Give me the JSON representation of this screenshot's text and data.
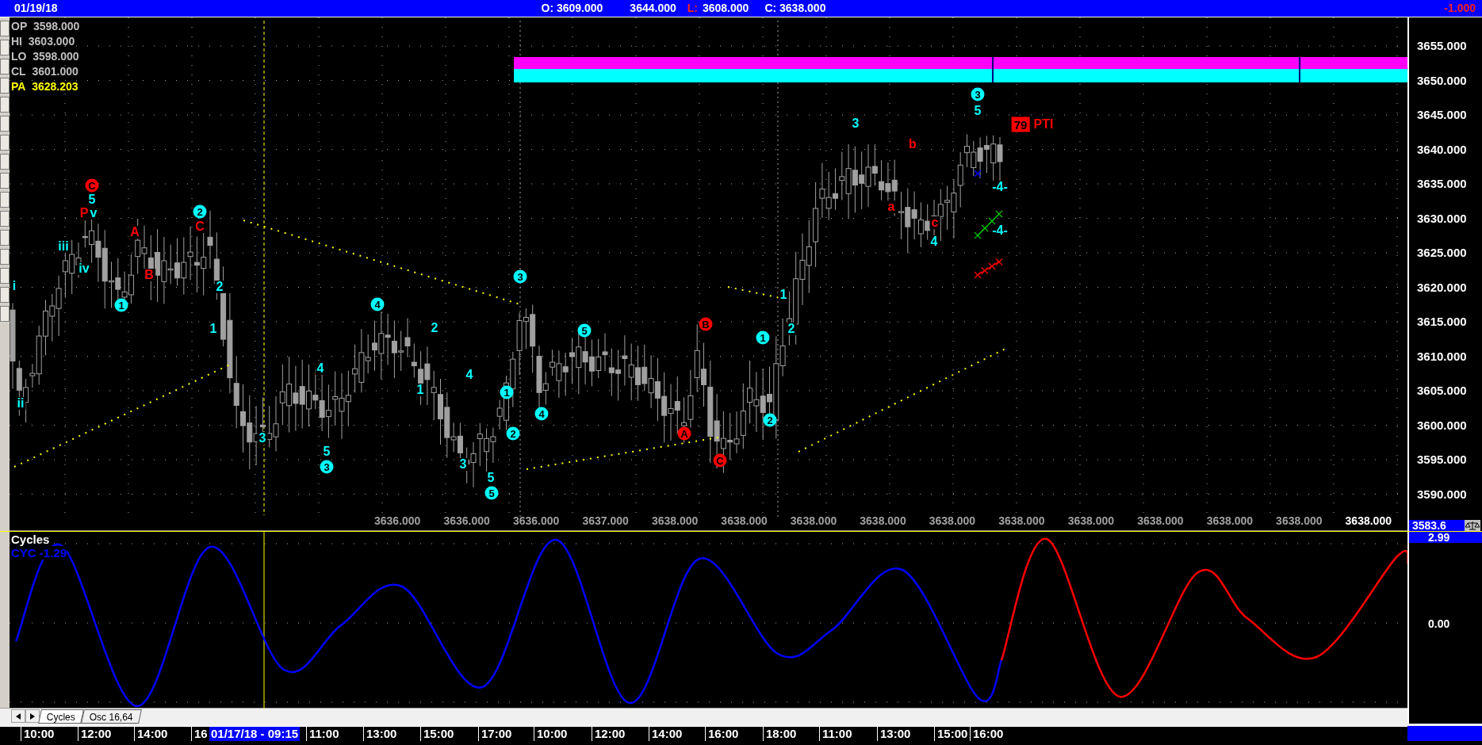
{
  "header": {
    "date": "01/19/18",
    "open": "O: 3609.000",
    "high": "3644.000",
    "low_label": "L:",
    "low": "3608.000",
    "close": "C: 3638.000",
    "change": "-1.000"
  },
  "price_chart": {
    "readouts": [
      {
        "label": "OP",
        "value": "3598.000",
        "kind": "ohlc"
      },
      {
        "label": "HI",
        "value": "3603.000",
        "kind": "ohlc"
      },
      {
        "label": "LO",
        "value": "3598.000",
        "kind": "ohlc"
      },
      {
        "label": "CL",
        "value": "3601.000",
        "kind": "ohlc"
      },
      {
        "label": "PA",
        "value": "3628.203",
        "kind": "average"
      }
    ],
    "wave_labels": [
      {
        "text": "i",
        "color": "#00ffff",
        "kind": "plain"
      },
      {
        "text": "ii",
        "color": "#00ffff",
        "kind": "plain"
      },
      {
        "text": "iii",
        "color": "#00ffff",
        "kind": "plain"
      },
      {
        "text": "iv",
        "color": "#00ffff",
        "kind": "plain"
      },
      {
        "text": "C",
        "color": "#ff0000",
        "kind": "circled"
      },
      {
        "text": "5",
        "color": "#00ffff",
        "kind": "plain"
      },
      {
        "text": "P",
        "color": "#ff0000",
        "kind": "plain"
      },
      {
        "text": "v",
        "color": "#00ffff",
        "kind": "plain"
      },
      {
        "text": "A",
        "color": "#ff0000",
        "kind": "plain"
      },
      {
        "text": "B",
        "color": "#ff0000",
        "kind": "plain"
      },
      {
        "text": "1",
        "color": "#00ffff",
        "kind": "circled"
      },
      {
        "text": "2",
        "color": "#00ffff",
        "kind": "circled"
      },
      {
        "text": "C",
        "color": "#ff0000",
        "kind": "plain"
      },
      {
        "text": "2",
        "color": "#00ffff",
        "kind": "plain"
      },
      {
        "text": "1",
        "color": "#00ffff",
        "kind": "plain"
      },
      {
        "text": "3",
        "color": "#00ffff",
        "kind": "plain"
      },
      {
        "text": "4",
        "color": "#00ffff",
        "kind": "plain"
      },
      {
        "text": "5",
        "color": "#00ffff",
        "kind": "plain"
      },
      {
        "text": "3",
        "color": "#00ffff",
        "kind": "circled"
      },
      {
        "text": "4",
        "color": "#00ffff",
        "kind": "circled"
      },
      {
        "text": "2",
        "color": "#00ffff",
        "kind": "plain"
      },
      {
        "text": "1",
        "color": "#00ffff",
        "kind": "plain"
      },
      {
        "text": "4",
        "color": "#00ffff",
        "kind": "plain"
      },
      {
        "text": "3",
        "color": "#00ffff",
        "kind": "plain"
      },
      {
        "text": "5",
        "color": "#00ffff",
        "kind": "plain"
      },
      {
        "text": "5",
        "color": "#00ffff",
        "kind": "circled"
      },
      {
        "text": "1",
        "color": "#00ffff",
        "kind": "circled"
      },
      {
        "text": "2",
        "color": "#00ffff",
        "kind": "circled"
      },
      {
        "text": "3",
        "color": "#00ffff",
        "kind": "circled"
      },
      {
        "text": "4",
        "color": "#00ffff",
        "kind": "circled"
      },
      {
        "text": "5",
        "color": "#00ffff",
        "kind": "circled"
      },
      {
        "text": "B",
        "color": "#ff0000",
        "kind": "circled"
      },
      {
        "text": "A",
        "color": "#ff0000",
        "kind": "circled"
      },
      {
        "text": "C",
        "color": "#ff0000",
        "kind": "circled"
      },
      {
        "text": "1",
        "color": "#00ffff",
        "kind": "circled"
      },
      {
        "text": "2",
        "color": "#00ffff",
        "kind": "circled"
      },
      {
        "text": "1",
        "color": "#00ffff",
        "kind": "plain"
      },
      {
        "text": "2",
        "color": "#00ffff",
        "kind": "plain"
      },
      {
        "text": "3",
        "color": "#00ffff",
        "kind": "plain"
      },
      {
        "text": "a",
        "color": "#ff0000",
        "kind": "plain"
      },
      {
        "text": "b",
        "color": "#ff0000",
        "kind": "plain"
      },
      {
        "text": "c",
        "color": "#ff0000",
        "kind": "plain"
      },
      {
        "text": "4",
        "color": "#00ffff",
        "kind": "plain"
      },
      {
        "text": "3",
        "color": "#00ffff",
        "kind": "circled"
      },
      {
        "text": "5",
        "color": "#00ffff",
        "kind": "plain"
      },
      {
        "text": "-4-",
        "color": "#00ffff",
        "kind": "plain"
      },
      {
        "text": "-4-",
        "color": "#00ffff",
        "kind": "plain"
      },
      {
        "text": "79",
        "color": "#ff0000",
        "kind": "boxed"
      },
      {
        "text": "PTI",
        "color": "#ff0000",
        "kind": "plain"
      }
    ],
    "price_axis": [
      "3655.000",
      "3650.000",
      "3645.000",
      "3640.000",
      "3635.000",
      "3630.000",
      "3625.000",
      "3620.000",
      "3615.000",
      "3610.000",
      "3605.000",
      "3600.000",
      "3595.000",
      "3590.000"
    ],
    "last_price": "3583.6",
    "column_values": [
      {
        "text": "3636.000",
        "kind": "past"
      },
      {
        "text": "3636.000",
        "kind": "past"
      },
      {
        "text": "3636.000",
        "kind": "past"
      },
      {
        "text": "3637.000",
        "kind": "past"
      },
      {
        "text": "3638.000",
        "kind": "past"
      },
      {
        "text": "3638.000",
        "kind": "past"
      },
      {
        "text": "3638.000",
        "kind": "past"
      },
      {
        "text": "3638.000",
        "kind": "past"
      },
      {
        "text": "3638.000",
        "kind": "past"
      },
      {
        "text": "3638.000",
        "kind": "past"
      },
      {
        "text": "3638.000",
        "kind": "past"
      },
      {
        "text": "3638.000",
        "kind": "past"
      },
      {
        "text": "3638.000",
        "kind": "past"
      },
      {
        "text": "3638.000",
        "kind": "past"
      },
      {
        "text": "3638.000",
        "kind": "current"
      }
    ]
  },
  "cycles_pane": {
    "title": "Cycles",
    "reading": "CYC -1.29",
    "axis": [
      {
        "text": "2.99",
        "kind": "marker"
      },
      {
        "text": "0.00",
        "kind": "tick"
      }
    ]
  },
  "pane_tabs": [
    {
      "label": "Cycles",
      "selected": true
    },
    {
      "label": "Osc 16,64",
      "selected": false
    }
  ],
  "time_axis": [
    {
      "label": "10:00",
      "selected": false
    },
    {
      "label": "12:00",
      "selected": false
    },
    {
      "label": "14:00",
      "selected": false
    },
    {
      "label": "16",
      "selected": false
    },
    {
      "label": "01/17/18 - 09:15",
      "selected": true
    },
    {
      "label": "11:00",
      "selected": false
    },
    {
      "label": "13:00",
      "selected": false
    },
    {
      "label": "15:00",
      "selected": false
    },
    {
      "label": "17:00",
      "selected": false
    },
    {
      "label": "10:00",
      "selected": false
    },
    {
      "label": "12:00",
      "selected": false
    },
    {
      "label": "14:00",
      "selected": false
    },
    {
      "label": "16:00",
      "selected": false
    },
    {
      "label": "18:00",
      "selected": false
    },
    {
      "label": "11:00",
      "selected": false
    },
    {
      "label": "13:00",
      "selected": false
    },
    {
      "label": "15:00",
      "selected": false
    },
    {
      "label": "16:00",
      "selected": false
    }
  ]
}
